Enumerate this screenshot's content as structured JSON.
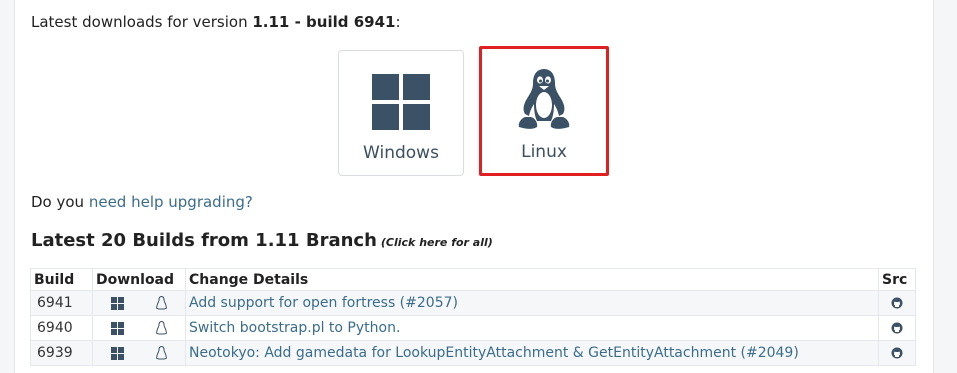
{
  "intro": {
    "prefix": "Latest downloads for version ",
    "version": "1.11",
    "separator": " - ",
    "build_label": "build 6941",
    "suffix": ":"
  },
  "downloads": {
    "windows_label": "Windows",
    "linux_label": "Linux",
    "colors": {
      "icon": "#3b5166",
      "highlight_border": "#e02020"
    }
  },
  "help": {
    "prefix": "Do you ",
    "link": "need help upgrading?"
  },
  "builds_section": {
    "title": "Latest 20 Builds from 1.11 Branch",
    "subtitle": "(Click here for all)"
  },
  "table": {
    "headers": {
      "build": "Build",
      "download": "Download",
      "details": "Change Details",
      "src": "Src"
    },
    "rows": [
      {
        "build": "6941",
        "details": "Add support for open fortress (#2057)"
      },
      {
        "build": "6940",
        "details": "Switch bootstrap.pl to Python."
      },
      {
        "build": "6939",
        "details": "Neotokyo: Add gamedata for LookupEntityAttachment & GetEntityAttachment (#2049)"
      }
    ]
  },
  "icons": [
    "windows-icon",
    "linux-icon",
    "github-icon"
  ]
}
